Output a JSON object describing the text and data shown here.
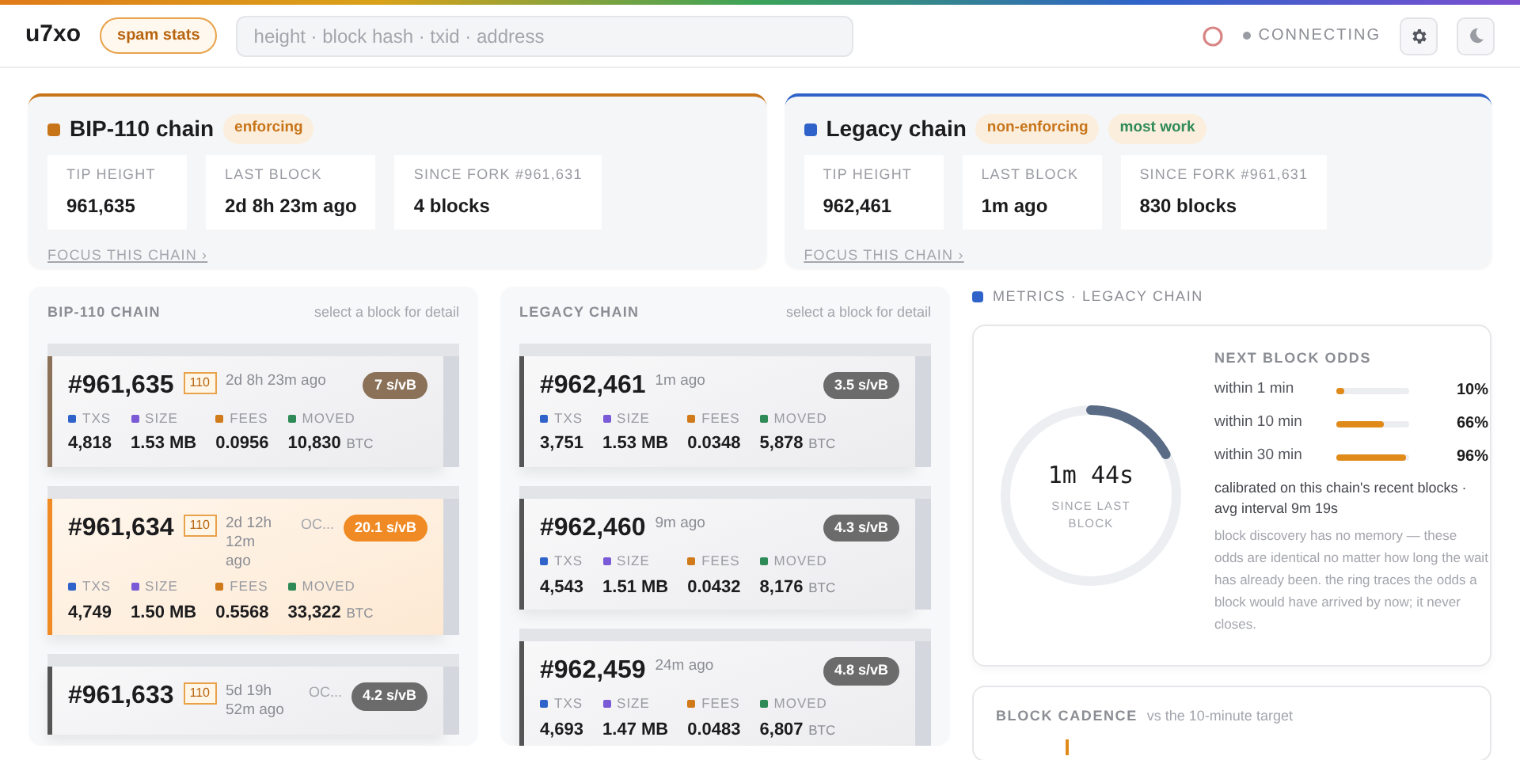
{
  "header": {
    "logo": "u7xo",
    "spam_button": "spam stats",
    "search": {
      "placeholder": "height · block hash · txid · address"
    },
    "status": "CONNECTING"
  },
  "chains": [
    {
      "name": "BIP-110 chain",
      "color": "#c8751a",
      "badges": [
        {
          "label": "enforcing",
          "color": "#c8751a"
        }
      ],
      "stats": [
        {
          "label": "TIP HEIGHT",
          "value": "961,635"
        },
        {
          "label": "LAST BLOCK",
          "value": "2d 8h 23m ago"
        },
        {
          "label": "SINCE FORK #961,631",
          "value": "4 blocks"
        }
      ],
      "link": "FOCUS THIS CHAIN ›"
    },
    {
      "name": "Legacy chain",
      "color": "#2f63c9",
      "badges": [
        {
          "label": "non-enforcing",
          "color": "#c8751a"
        },
        {
          "label": "most work",
          "color": "#2e8a57"
        }
      ],
      "stats": [
        {
          "label": "TIP HEIGHT",
          "value": "962,461"
        },
        {
          "label": "LAST BLOCK",
          "value": "1m ago"
        },
        {
          "label": "SINCE FORK #961,631",
          "value": "830 blocks"
        }
      ],
      "link": "FOCUS THIS CHAIN ›"
    }
  ],
  "columns": [
    {
      "title": "BIP-110 CHAIN",
      "hint": "select a block for detail",
      "blocks": [
        {
          "height": "#961,635",
          "tag": "110",
          "time": "2d 8h 23m ago",
          "rate": "7 s/vB",
          "color": "#8a7158",
          "selected": false,
          "stats": [
            {
              "label": "TXS",
              "value": "4,818"
            },
            {
              "label": "SIZE",
              "value": "1.53 MB"
            },
            {
              "label": "FEES",
              "value": "0.0956"
            },
            {
              "label": "MOVED",
              "value": "10,830",
              "unit": "BTC"
            }
          ]
        },
        {
          "height": "#961,634",
          "tag": "110",
          "time": "2d 12h 12m ago",
          "pool": "OC...",
          "rate": "20.1 s/vB",
          "color": "#f08a24",
          "selected": true,
          "stats": [
            {
              "label": "TXS",
              "value": "4,749"
            },
            {
              "label": "SIZE",
              "value": "1.50 MB"
            },
            {
              "label": "FEES",
              "value": "0.5568"
            },
            {
              "label": "MOVED",
              "value": "33,322",
              "unit": "BTC"
            }
          ]
        },
        {
          "height": "#961,633",
          "tag": "110",
          "time": "5d 19h 52m ago",
          "pool": "OC...",
          "rate": "4.2 s/vB",
          "color": "#6b6b6b",
          "selected": false
        }
      ]
    },
    {
      "title": "LEGACY CHAIN",
      "hint": "select a block for detail",
      "blocks": [
        {
          "height": "#962,461",
          "time": "1m ago",
          "rate": "3.5 s/vB",
          "color": "#6b6b6b",
          "selected": false,
          "stats": [
            {
              "label": "TXS",
              "value": "3,751"
            },
            {
              "label": "SIZE",
              "value": "1.53 MB"
            },
            {
              "label": "FEES",
              "value": "0.0348"
            },
            {
              "label": "MOVED",
              "value": "5,878",
              "unit": "BTC"
            }
          ]
        },
        {
          "height": "#962,460",
          "time": "9m ago",
          "rate": "4.3 s/vB",
          "color": "#6b6b6b",
          "selected": false,
          "stats": [
            {
              "label": "TXS",
              "value": "4,543"
            },
            {
              "label": "SIZE",
              "value": "1.51 MB"
            },
            {
              "label": "FEES",
              "value": "0.0432"
            },
            {
              "label": "MOVED",
              "value": "8,176",
              "unit": "BTC"
            }
          ]
        },
        {
          "height": "#962,459",
          "time": "24m ago",
          "rate": "4.8 s/vB",
          "color": "#6b6b6b",
          "selected": false,
          "stats": [
            {
              "label": "TXS",
              "value": "4,693"
            },
            {
              "label": "SIZE",
              "value": "1.47 MB"
            },
            {
              "label": "FEES",
              "value": "0.0483"
            },
            {
              "label": "MOVED",
              "value": "6,807",
              "unit": "BTC"
            }
          ]
        }
      ]
    }
  ],
  "metrics": {
    "title": "METRICS · LEGACY CHAIN",
    "color": "#2f63c9",
    "ring": {
      "time": "1m 44s",
      "caption": "SINCE LAST BLOCK",
      "level": 0.17
    },
    "odds_title": "NEXT BLOCK ODDS",
    "odds": [
      {
        "label": "within 1 min",
        "level": 0.1,
        "reading": "10%"
      },
      {
        "label": "within 10 min",
        "level": 0.66,
        "reading": "66%"
      },
      {
        "label": "within 30 min",
        "level": 0.96,
        "reading": "96%"
      }
    ],
    "calibration": "calibrated on this chain's recent blocks · avg interval 9m 19s",
    "note": "block discovery has no memory — these odds are identical no matter how long the wait has already been. the ring traces the odds a block would have arrived by now; it never closes."
  },
  "cadence": {
    "title": "BLOCK CADENCE",
    "subtitle": "vs the 10-minute target"
  }
}
